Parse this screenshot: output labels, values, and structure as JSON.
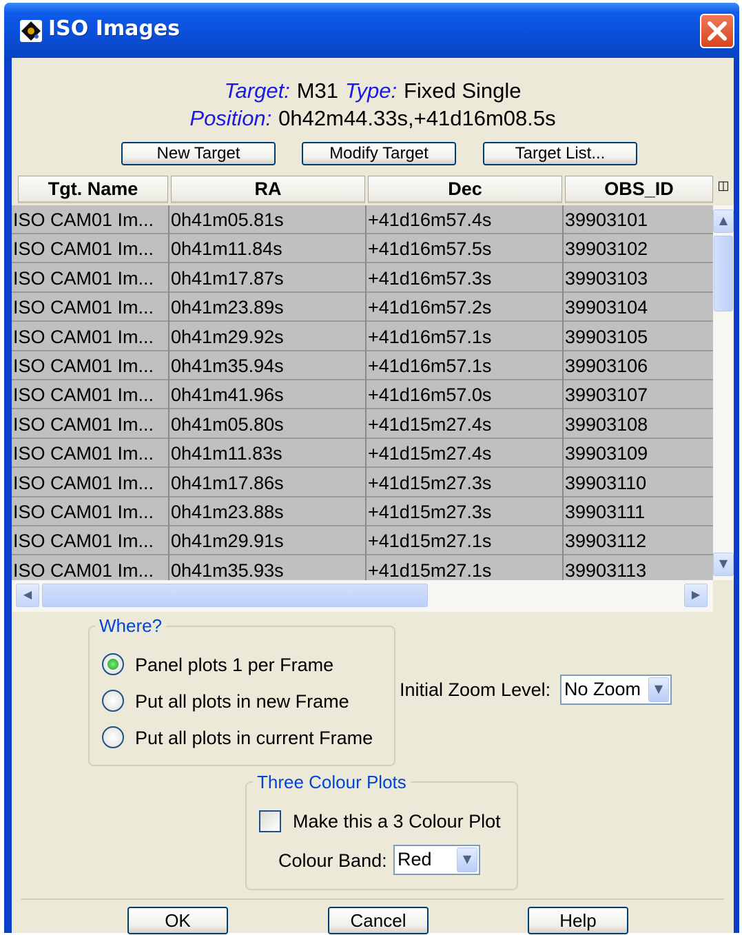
{
  "window": {
    "title": "ISO Images",
    "icon": "app-icon",
    "close_icon": "close-icon"
  },
  "target_info": {
    "target_label": "Target:",
    "target_value": "M31",
    "type_label": "Type:",
    "type_value": "Fixed Single",
    "position_label": "Position:",
    "position_value": "0h42m44.33s,+41d16m08.5s"
  },
  "target_buttons": {
    "new": "New Target",
    "modify": "Modify Target",
    "list": "Target List..."
  },
  "table": {
    "columns": [
      "Tgt. Name",
      "RA",
      "Dec",
      "OBS_ID"
    ],
    "column_chooser_icon": "column-chooser-icon",
    "rows": [
      [
        "ISO CAM01  Im...",
        "0h41m05.81s",
        "+41d16m57.4s",
        "39903101"
      ],
      [
        "ISO CAM01  Im...",
        "0h41m11.84s",
        "+41d16m57.5s",
        "39903102"
      ],
      [
        "ISO CAM01  Im...",
        "0h41m17.87s",
        "+41d16m57.3s",
        "39903103"
      ],
      [
        "ISO CAM01  Im...",
        "0h41m23.89s",
        "+41d16m57.2s",
        "39903104"
      ],
      [
        "ISO CAM01  Im...",
        "0h41m29.92s",
        "+41d16m57.1s",
        "39903105"
      ],
      [
        "ISO CAM01  Im...",
        "0h41m35.94s",
        "+41d16m57.1s",
        "39903106"
      ],
      [
        "ISO CAM01  Im...",
        "0h41m41.96s",
        "+41d16m57.0s",
        "39903107"
      ],
      [
        "ISO CAM01  Im...",
        "0h41m05.80s",
        "+41d15m27.4s",
        "39903108"
      ],
      [
        "ISO CAM01  Im...",
        "0h41m11.83s",
        "+41d15m27.4s",
        "39903109"
      ],
      [
        "ISO CAM01  Im...",
        "0h41m17.86s",
        "+41d15m27.3s",
        "39903110"
      ],
      [
        "ISO CAM01  Im...",
        "0h41m23.88s",
        "+41d15m27.3s",
        "39903111"
      ],
      [
        "ISO CAM01  Im...",
        "0h41m29.91s",
        "+41d15m27.1s",
        "39903112"
      ],
      [
        "ISO CAM01  Im...",
        "0h41m35.93s",
        "+41d15m27.1s",
        "39903113"
      ]
    ],
    "colors": {
      "row_bg": "#c0c0c0",
      "row_border": "#9a9a9a"
    }
  },
  "where_group": {
    "legend": "Where?",
    "options": [
      "Panel plots 1 per Frame",
      "Put all plots in new Frame",
      "Put all plots in current Frame"
    ],
    "selected_index": 0
  },
  "zoom": {
    "label": "Initial Zoom Level:",
    "value": "No Zoom"
  },
  "three_colour": {
    "legend": "Three Colour Plots",
    "checkbox_label": "Make this a 3 Colour Plot",
    "checked": false,
    "band_label": "Colour Band:",
    "band_value": "Red"
  },
  "footer": {
    "ok": "OK",
    "cancel": "Cancel",
    "help": "Help"
  },
  "colors": {
    "title_bar": "#0a4fd8",
    "dialog_bg": "#ece9d8",
    "label_blue": "#1a1ae0",
    "legend_blue": "#0046d5"
  }
}
